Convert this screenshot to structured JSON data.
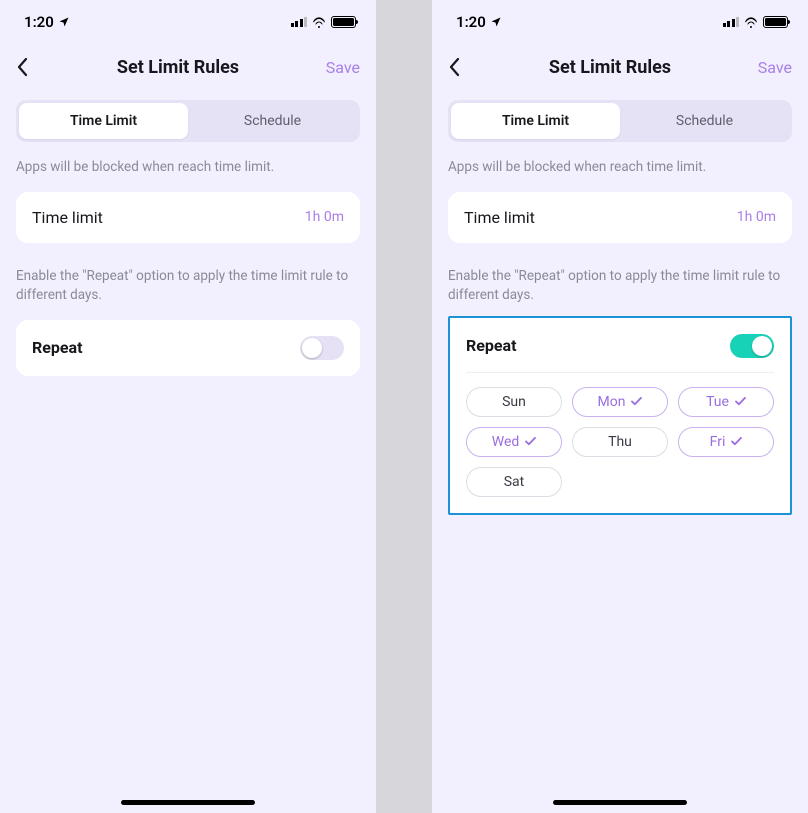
{
  "status": {
    "time": "1:20"
  },
  "nav": {
    "title": "Set Limit Rules",
    "save": "Save"
  },
  "tabs": {
    "time_limit": "Time Limit",
    "schedule": "Schedule"
  },
  "hint1": "Apps will be blocked when reach time limit.",
  "timelimit": {
    "label": "Time limit",
    "value": "1h 0m"
  },
  "hint2": "Enable the \"Repeat\" option to apply the time limit rule to different days.",
  "repeat": {
    "label": "Repeat"
  },
  "days": [
    {
      "label": "Sun",
      "selected": false
    },
    {
      "label": "Mon",
      "selected": true
    },
    {
      "label": "Tue",
      "selected": true
    },
    {
      "label": "Wed",
      "selected": true
    },
    {
      "label": "Thu",
      "selected": false
    },
    {
      "label": "Fri",
      "selected": true
    },
    {
      "label": "Sat",
      "selected": false
    }
  ],
  "screens": {
    "left": {
      "repeat_on": false,
      "highlight": false
    },
    "right": {
      "repeat_on": true,
      "highlight": true
    }
  }
}
